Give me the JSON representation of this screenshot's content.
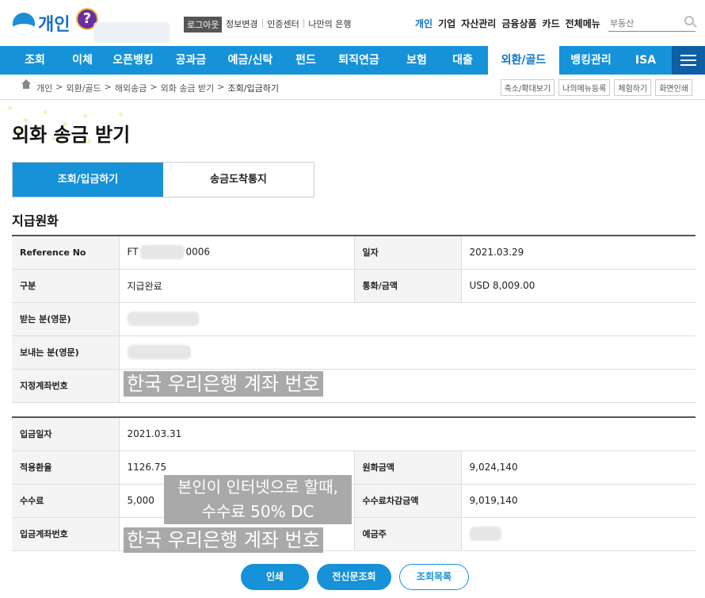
{
  "header": {
    "logo_text": "개인",
    "help_label": "?",
    "logout_label": "로그아웃",
    "top_links": [
      "정보변경",
      "인증센터",
      "나만의 은행"
    ],
    "biz_links": [
      "개인",
      "기업",
      "자산관리",
      "금융상품",
      "카드",
      "전체메뉴"
    ],
    "search_placeholder": "부동산"
  },
  "gnb": {
    "items": [
      "조회",
      "이체",
      "오픈뱅킹",
      "공과금",
      "예금/신탁",
      "펀드",
      "퇴직연금",
      "보험",
      "대출",
      "외환/골드",
      "뱅킹관리",
      "ISA"
    ],
    "active_index": 9
  },
  "breadcrumb": {
    "items": [
      "개인",
      "외환/골드",
      "해외송금",
      "외화 송금 받기",
      "조회/입금하기"
    ],
    "separator": ">",
    "tools": [
      "축소/확대보기",
      "나의메뉴등록",
      "체험하기",
      "화면인쇄"
    ]
  },
  "page": {
    "title": "외화 송금 받기",
    "tabs": [
      "조회/입금하기",
      "송금도착통지"
    ],
    "section_title": "지급원화"
  },
  "table1": {
    "ref_label": "Reference No",
    "ref_prefix": "FT",
    "ref_suffix": "0006",
    "date_label": "일자",
    "date_value": "2021.03.29",
    "type_label": "구분",
    "type_value": "지급완료",
    "currency_label": "통화/금액",
    "currency_value": "USD 8,009.00",
    "receiver_label": "받는 분(영문)",
    "sender_label": "보내는 분(영문)",
    "account_label": "지정계좌번호",
    "account_overlay": "한국 우리은행 계좌 번호"
  },
  "table2": {
    "deposit_date_label": "입금일자",
    "deposit_date_value": "2021.03.31",
    "rate_label": "적용환율",
    "rate_value": "1126.75",
    "krw_label": "원화금액",
    "krw_value": "9,024,140",
    "fee_label": "수수료",
    "fee_value": "5,000",
    "net_label": "수수료차감금액",
    "net_value": "9,019,140",
    "acct_label": "입금계좌번호",
    "acct_overlay": "한국 우리은행 계좌 번호",
    "holder_label": "예금주",
    "note_line1": "본인이 인터넷으로 할때,",
    "note_line2": "수수료 50% DC"
  },
  "buttons": {
    "print": "인쇄",
    "swift": "전신문조회",
    "list": "조회목록"
  }
}
